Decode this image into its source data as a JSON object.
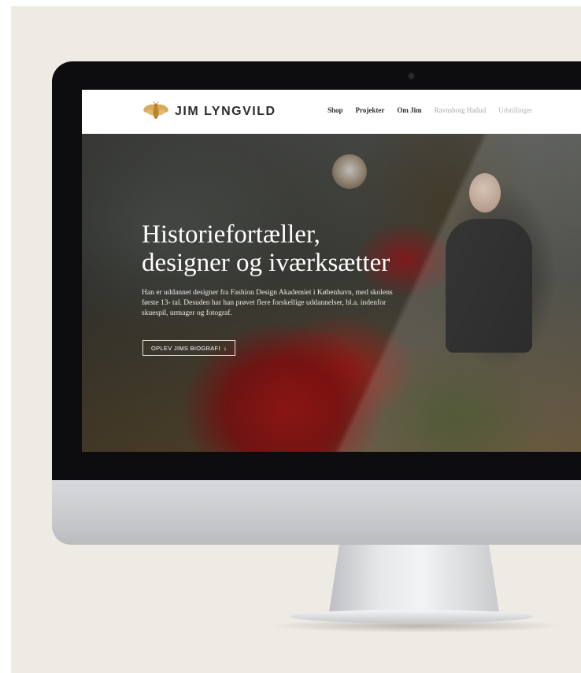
{
  "brand": {
    "name": "JIM LYNGVILD",
    "logo_icon": "bee-icon",
    "accent_color": "#c8963e"
  },
  "nav": {
    "items": [
      {
        "label": "Shop",
        "active": true
      },
      {
        "label": "Projekter",
        "active": true
      },
      {
        "label": "Om Jim",
        "active": true
      },
      {
        "label": "Ravnsborg Hatlud",
        "active": false
      },
      {
        "label": "Udstillinger",
        "active": false
      }
    ]
  },
  "hero": {
    "title_line1": "Historiefortæller,",
    "title_line2": "designer og iværksætter",
    "body": "Han er uddannet designer fra Fashion Design Akademiet i København, med skolens første 13- tal. Desuden har han prøvet flere forskellige uddannelser, bl.a. indenfor skuespil, urmager og fotograf.",
    "button_label": "OPLEV JIMS BIOGRAFI",
    "button_icon": "arrow-down-icon"
  }
}
